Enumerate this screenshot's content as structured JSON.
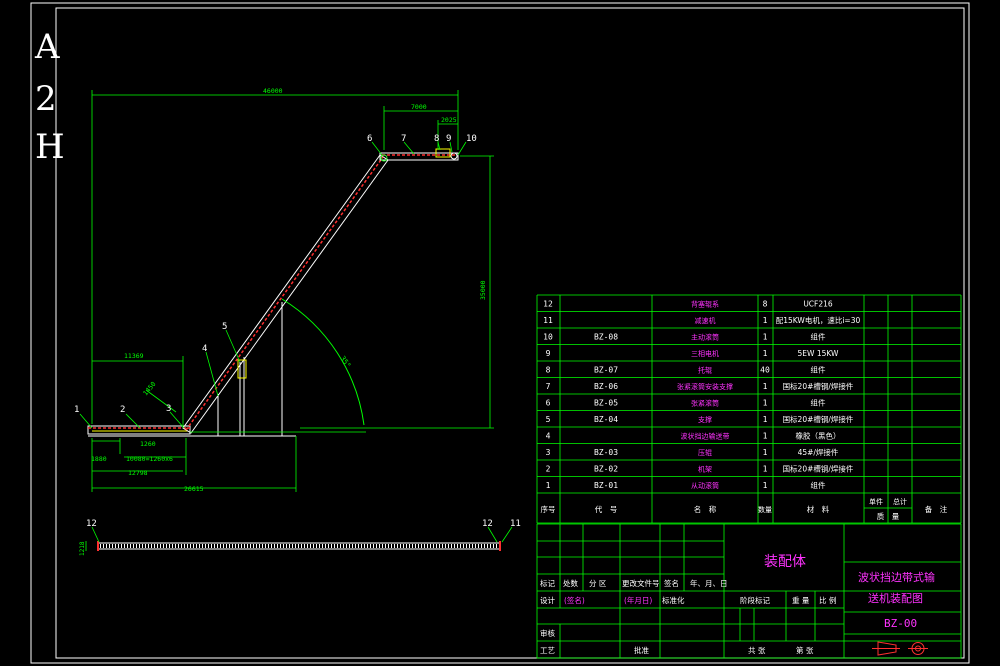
{
  "sheet": {
    "size_label": [
      "A",
      "2",
      "H"
    ]
  },
  "dimensions": {
    "overall_length": "46000",
    "top_length": "7000",
    "top_small": "2025",
    "height": "35000",
    "lower_length": "11369",
    "tail_left": "1880",
    "tail_pitch": "1260",
    "tail_series": "10080=1260x6",
    "base_mid": "12798",
    "base_total": "26615",
    "angle": "35°",
    "incline_small": "1450",
    "strip_height": "1218"
  },
  "balloons": {
    "b1": "1",
    "b2": "2",
    "b3": "3",
    "b4": "4",
    "b5": "5",
    "b6": "6",
    "b7": "7",
    "b8": "8",
    "b9": "9",
    "b10": "10",
    "b11": "11",
    "b12a": "12",
    "b12b": "12"
  },
  "parts_table": {
    "rows": [
      {
        "no": "12",
        "code": "",
        "name": "背塞辊系",
        "qty": "8",
        "material": "UCF216",
        "w1": "",
        "w2": "",
        "note": ""
      },
      {
        "no": "11",
        "code": "",
        "name": "减速机",
        "qty": "1",
        "material": "配15KW电机，速比i=30",
        "w1": "",
        "w2": "",
        "note": ""
      },
      {
        "no": "10",
        "code": "BZ-08",
        "name": "主动滚筒",
        "qty": "1",
        "material": "组件",
        "w1": "",
        "w2": "",
        "note": ""
      },
      {
        "no": "9",
        "code": "",
        "name": "三相电机",
        "qty": "1",
        "material": "5EW 15KW",
        "w1": "",
        "w2": "",
        "note": ""
      },
      {
        "no": "8",
        "code": "BZ-07",
        "name": "托辊",
        "qty": "40",
        "material": "组件",
        "w1": "",
        "w2": "",
        "note": ""
      },
      {
        "no": "7",
        "code": "BZ-06",
        "name": "张紧滚筒安装支撑",
        "qty": "1",
        "material": "国标20#槽钢/焊接件",
        "w1": "",
        "w2": "",
        "note": ""
      },
      {
        "no": "6",
        "code": "BZ-05",
        "name": "张紧滚筒",
        "qty": "1",
        "material": "组件",
        "w1": "",
        "w2": "",
        "note": ""
      },
      {
        "no": "5",
        "code": "BZ-04",
        "name": "支撑",
        "qty": "1",
        "material": "国标20#槽钢/焊接件",
        "w1": "",
        "w2": "",
        "note": ""
      },
      {
        "no": "4",
        "code": "",
        "name": "波状挡边输送带",
        "qty": "1",
        "material": "橡胶（黑色）",
        "w1": "",
        "w2": "",
        "note": ""
      },
      {
        "no": "3",
        "code": "BZ-03",
        "name": "压辊",
        "qty": "1",
        "material": "45#/焊接件",
        "w1": "",
        "w2": "",
        "note": ""
      },
      {
        "no": "2",
        "code": "BZ-02",
        "name": "机架",
        "qty": "1",
        "material": "国标20#槽钢/焊接件",
        "w1": "",
        "w2": "",
        "note": ""
      },
      {
        "no": "1",
        "code": "BZ-01",
        "name": "从动滚筒",
        "qty": "1",
        "material": "组件",
        "w1": "",
        "w2": "",
        "note": ""
      }
    ],
    "header": {
      "no": "序号",
      "code": "代　号",
      "name": "名　称",
      "qty": "数量",
      "material": "材　料",
      "single": "单件",
      "total": "总计",
      "weight": "质　量",
      "note": "备　注"
    }
  },
  "title_block": {
    "assembly": "装配体",
    "drawing_title_1": "波状挡边带式输",
    "drawing_title_2": "送机装配图",
    "drawing_no": "BZ-00",
    "labels": {
      "mark": "标记",
      "count": "处数",
      "zone": "分 区",
      "change_doc": "更改文件号",
      "signature": "签名",
      "date": "年、月、日",
      "design": "设计",
      "sign_ph": "(签名)",
      "date_ph": "(年月日)",
      "standard": "标准化",
      "stage": "阶段标记",
      "weight": "重 量",
      "scale": "比 例",
      "review": "审核",
      "process": "工艺",
      "approve": "批准",
      "sheets_total": "共 张",
      "sheet_no": "第 张"
    }
  },
  "colors": {
    "background": "#000000",
    "frame": "#ffffff",
    "table": "#00ff00",
    "dimension": "#00ff00",
    "text_magenta": "#ff33ff",
    "text_yellow": "#ffff00",
    "text_cyan": "#33ffff",
    "belt_red": "#ff3030",
    "title_red": "#ff3030"
  }
}
